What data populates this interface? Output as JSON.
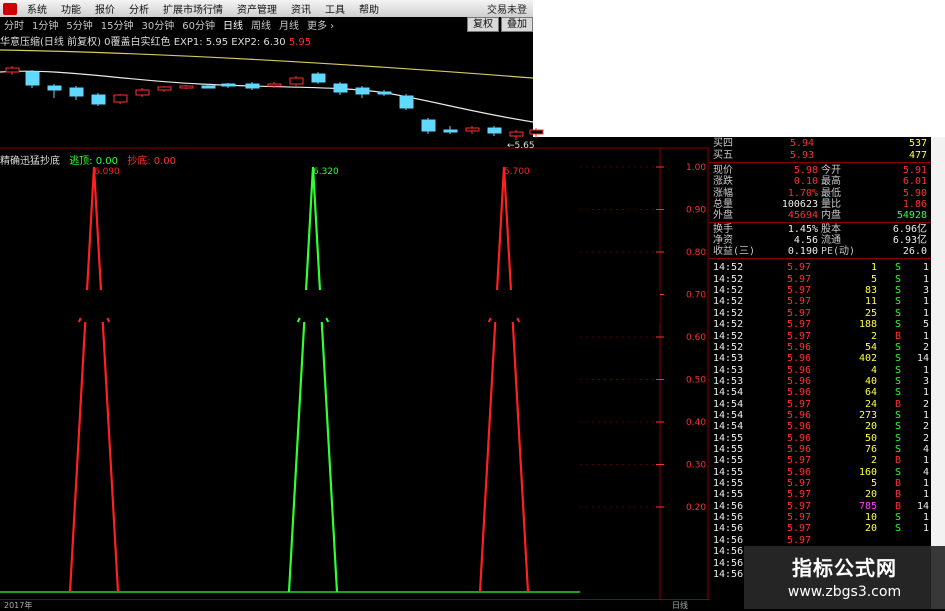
{
  "menu": [
    "系统",
    "功能",
    "报价",
    "分析",
    "扩展市场行情",
    "资产管理",
    "资讯",
    "工具",
    "帮助"
  ],
  "brand": "交易未登",
  "periods": [
    "分时",
    "1分钟",
    "5分钟",
    "15分钟",
    "30分钟",
    "60分钟",
    "日线",
    "周线",
    "月线",
    "更多 ›"
  ],
  "active_period": "日线",
  "right_buttons": [
    "复权",
    "叠加"
  ],
  "legend_top": {
    "main": "华意压缩(日线 前复权) 0覆盖白实红色 EXP1: 5.95 EXP2: 6.30",
    "value2": "5.95"
  },
  "price_low_label": "←5.65",
  "legend_bottom": {
    "name": "精确迅猛抄底",
    "g_label": "逃顶: 0.00",
    "r_label": "抄底: 0.00"
  },
  "chart_data": {
    "type": "line",
    "ylim": [
      0,
      1
    ],
    "yticks": [
      "1.00",
      "0.90",
      "0.80",
      "0.70",
      "0.60",
      "0.50",
      "0.40",
      "0.30",
      "0.20"
    ],
    "peaks": [
      {
        "label": "6.090",
        "color": "#ff2020",
        "value": 1.0
      },
      {
        "label": "6.320",
        "color": "#30ff30",
        "value": 1.0
      },
      {
        "label": "5.700",
        "color": "#ff2020",
        "value": 1.0
      }
    ]
  },
  "footer": {
    "left": "2017年",
    "right": "日线"
  },
  "order_book": [
    {
      "label": "买四",
      "price": "5.94",
      "vol": "537"
    },
    {
      "label": "买五",
      "price": "5.93",
      "vol": "477"
    }
  ],
  "stats": [
    {
      "l1": "现价",
      "v1": "5.98",
      "c1": "red",
      "l2": "今开",
      "v2": "5.91",
      "c2": "red"
    },
    {
      "l1": "涨跌",
      "v1": "0.10",
      "c1": "red",
      "l2": "最高",
      "v2": "6.01",
      "c2": "red"
    },
    {
      "l1": "涨幅",
      "v1": "1.70%",
      "c1": "red",
      "l2": "最低",
      "v2": "5.90",
      "c2": "red"
    },
    {
      "l1": "总量",
      "v1": "100623",
      "c1": "wht",
      "l2": "量比",
      "v2": "1.86",
      "c2": "red"
    },
    {
      "l1": "外盘",
      "v1": "45694",
      "c1": "red",
      "l2": "内盘",
      "v2": "54928",
      "c2": "grn"
    },
    {
      "l1": "换手",
      "v1": "1.45%",
      "c1": "wht",
      "l2": "股本",
      "v2": "6.96亿",
      "c2": "wht"
    },
    {
      "l1": "净资",
      "v1": "4.56",
      "c1": "wht",
      "l2": "流通",
      "v2": "6.93亿",
      "c2": "wht"
    },
    {
      "l1": "收益(三)",
      "v1": "0.190",
      "c1": "wht",
      "l2": "PE(动)",
      "v2": "26.0",
      "c2": "wht"
    }
  ],
  "ticks": [
    {
      "t": "14:52",
      "p": "5.97",
      "v": "1",
      "s": "S",
      "n": "1"
    },
    {
      "t": "14:52",
      "p": "5.97",
      "v": "5",
      "s": "S",
      "n": "1"
    },
    {
      "t": "14:52",
      "p": "5.97",
      "v": "83",
      "s": "S",
      "n": "3"
    },
    {
      "t": "14:52",
      "p": "5.97",
      "v": "11",
      "s": "S",
      "n": "1"
    },
    {
      "t": "14:52",
      "p": "5.97",
      "v": "25",
      "s": "S",
      "n": "1"
    },
    {
      "t": "14:52",
      "p": "5.97",
      "v": "188",
      "s": "S",
      "n": "5"
    },
    {
      "t": "14:52",
      "p": "5.97",
      "v": "2",
      "s": "B",
      "n": "1"
    },
    {
      "t": "14:52",
      "p": "5.96",
      "v": "54",
      "s": "S",
      "n": "2"
    },
    {
      "t": "14:53",
      "p": "5.96",
      "v": "402",
      "s": "S",
      "n": "14"
    },
    {
      "t": "14:53",
      "p": "5.96",
      "v": "4",
      "s": "S",
      "n": "1"
    },
    {
      "t": "14:53",
      "p": "5.96",
      "v": "40",
      "s": "S",
      "n": "3"
    },
    {
      "t": "14:54",
      "p": "5.96",
      "v": "64",
      "s": "S",
      "n": "1"
    },
    {
      "t": "14:54",
      "p": "5.97",
      "v": "24",
      "s": "B",
      "n": "2"
    },
    {
      "t": "14:54",
      "p": "5.96",
      "v": "273",
      "s": "S",
      "n": "1"
    },
    {
      "t": "14:54",
      "p": "5.96",
      "v": "20",
      "s": "S",
      "n": "2"
    },
    {
      "t": "14:55",
      "p": "5.96",
      "v": "50",
      "s": "S",
      "n": "2"
    },
    {
      "t": "14:55",
      "p": "5.96",
      "v": "76",
      "s": "S",
      "n": "4"
    },
    {
      "t": "14:55",
      "p": "5.97",
      "v": "2",
      "s": "B",
      "n": "1"
    },
    {
      "t": "14:55",
      "p": "5.96",
      "v": "160",
      "s": "S",
      "n": "4"
    },
    {
      "t": "14:55",
      "p": "5.97",
      "v": "5",
      "s": "B",
      "n": "1"
    },
    {
      "t": "14:55",
      "p": "5.97",
      "v": "20",
      "s": "B",
      "n": "1"
    },
    {
      "t": "14:56",
      "p": "5.97",
      "v": "785",
      "s": "B",
      "n": "14",
      "mag": true
    },
    {
      "t": "14:56",
      "p": "5.97",
      "v": "10",
      "s": "S",
      "n": "1"
    },
    {
      "t": "14:56",
      "p": "5.97",
      "v": "20",
      "s": "S",
      "n": "1"
    },
    {
      "t": "14:56",
      "p": "5.97",
      "v": "",
      "s": "",
      "n": ""
    },
    {
      "t": "14:56",
      "p": "",
      "v": "",
      "s": "",
      "n": ""
    },
    {
      "t": "14:56",
      "p": "",
      "v": "",
      "s": "",
      "n": ""
    },
    {
      "t": "14:56",
      "p": "",
      "v": "",
      "s": "",
      "n": ""
    }
  ],
  "watermark": {
    "line1": "指标公式网",
    "line2": "www.zbgs3.com"
  }
}
